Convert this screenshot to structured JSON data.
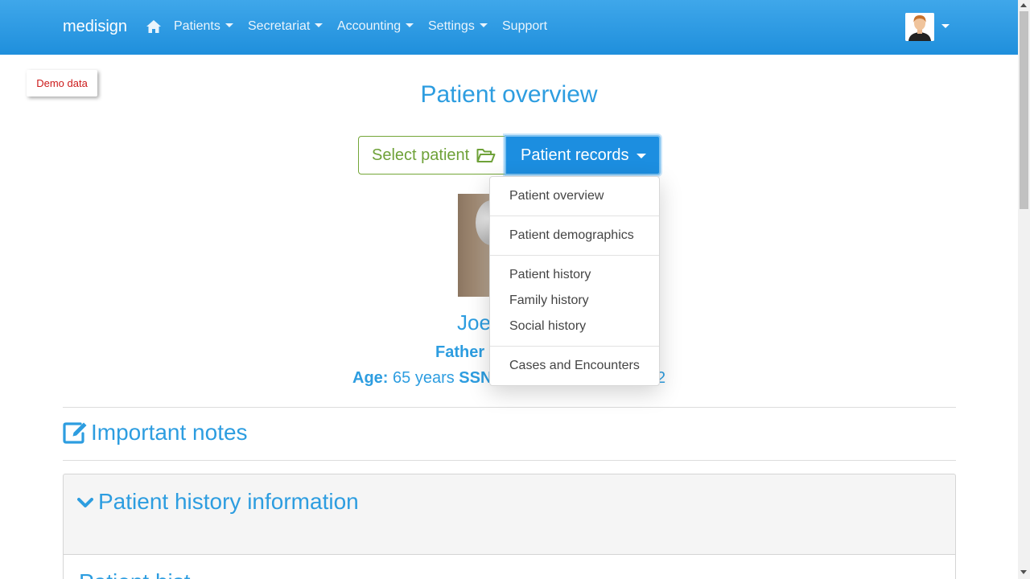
{
  "navbar": {
    "brand": "medisign",
    "items": [
      {
        "label": "Patients"
      },
      {
        "label": "Secretariat"
      },
      {
        "label": "Accounting"
      },
      {
        "label": "Settings"
      },
      {
        "label": "Support"
      }
    ],
    "home_icon": "home-icon",
    "user_icon": "user-avatar"
  },
  "demo_badge": "Demo data",
  "page_title": "Patient overview",
  "buttons": {
    "select_patient": "Select patient",
    "patient_records": "Patient records"
  },
  "dropdown": {
    "items": [
      "Patient overview",
      "Patient demographics",
      "Patient history",
      "Family history",
      "Social history",
      "Cases and Encounters"
    ]
  },
  "patient": {
    "name_visible": "Joe",
    "role_visible": "Father",
    "age_label": "Age:",
    "age_value": "65 years",
    "ssn_label": "SSN",
    "ssn_tail_visible": "2"
  },
  "sections": {
    "important_notes": "Important notes",
    "history_info": "Patient history information",
    "history_sub_visible": "Patient hist"
  },
  "colors": {
    "primary": "#2d9de0",
    "navbar": "#2a97e0",
    "success": "#6ea138",
    "danger": "#cc1a1a"
  }
}
